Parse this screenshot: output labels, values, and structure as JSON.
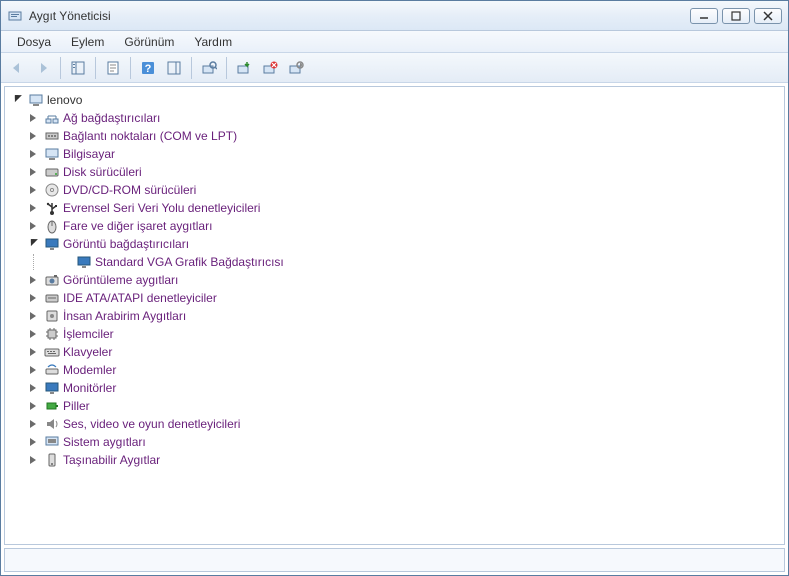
{
  "window": {
    "title": "Aygıt Yöneticisi"
  },
  "menu": {
    "file": "Dosya",
    "action": "Eylem",
    "view": "Görünüm",
    "help": "Yardım"
  },
  "tree": {
    "root": "lenovo",
    "categories": [
      {
        "label": "Ağ bağdaştırıcıları",
        "icon": "network"
      },
      {
        "label": "Bağlantı noktaları (COM ve LPT)",
        "icon": "port"
      },
      {
        "label": "Bilgisayar",
        "icon": "computer"
      },
      {
        "label": "Disk sürücüleri",
        "icon": "disk"
      },
      {
        "label": "DVD/CD-ROM sürücüleri",
        "icon": "dvd"
      },
      {
        "label": "Evrensel Seri Veri Yolu denetleyicileri",
        "icon": "usb"
      },
      {
        "label": "Fare ve diğer işaret aygıtları",
        "icon": "mouse"
      },
      {
        "label": "Görüntü bağdaştırıcıları",
        "icon": "display",
        "expanded": true,
        "children": [
          {
            "label": "Standard VGA Grafik Bağdaştırıcısı",
            "icon": "display"
          }
        ]
      },
      {
        "label": "Görüntüleme aygıtları",
        "icon": "imaging"
      },
      {
        "label": "IDE ATA/ATAPI denetleyiciler",
        "icon": "ide"
      },
      {
        "label": "İnsan Arabirim Aygıtları",
        "icon": "hid"
      },
      {
        "label": "İşlemciler",
        "icon": "cpu"
      },
      {
        "label": "Klavyeler",
        "icon": "keyboard"
      },
      {
        "label": "Modemler",
        "icon": "modem"
      },
      {
        "label": "Monitörler",
        "icon": "monitor"
      },
      {
        "label": "Piller",
        "icon": "battery"
      },
      {
        "label": "Ses, video ve oyun denetleyicileri",
        "icon": "sound"
      },
      {
        "label": "Sistem aygıtları",
        "icon": "system"
      },
      {
        "label": "Taşınabilir Aygıtlar",
        "icon": "portable"
      }
    ]
  }
}
